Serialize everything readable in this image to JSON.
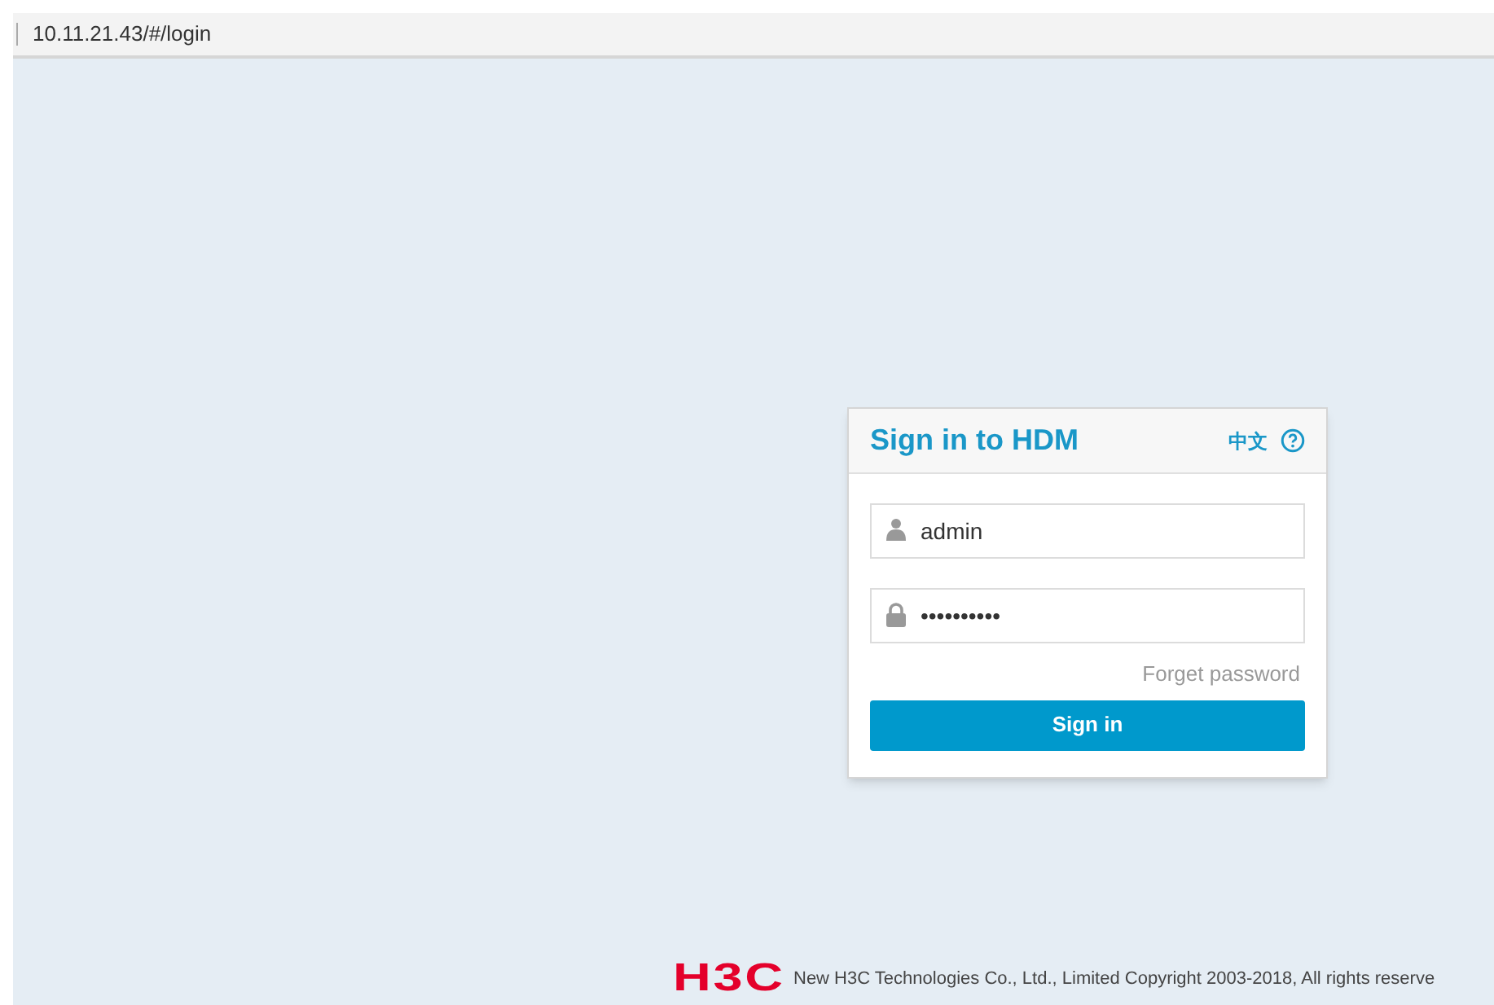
{
  "address_bar": {
    "url": "10.11.21.43/#/login"
  },
  "login": {
    "title": "Sign in to HDM",
    "language": "中文",
    "fields": [
      {
        "kind": "user",
        "value": "admin"
      },
      {
        "kind": "password",
        "value": "••••••••••"
      }
    ],
    "forgot_link": "Forget password",
    "submit": "Sign in"
  },
  "footer": {
    "logo": "H3C",
    "copyright": "New H3C Technologies Co., Ltd., Limited Copyright 2003-2018, All rights reserve"
  }
}
